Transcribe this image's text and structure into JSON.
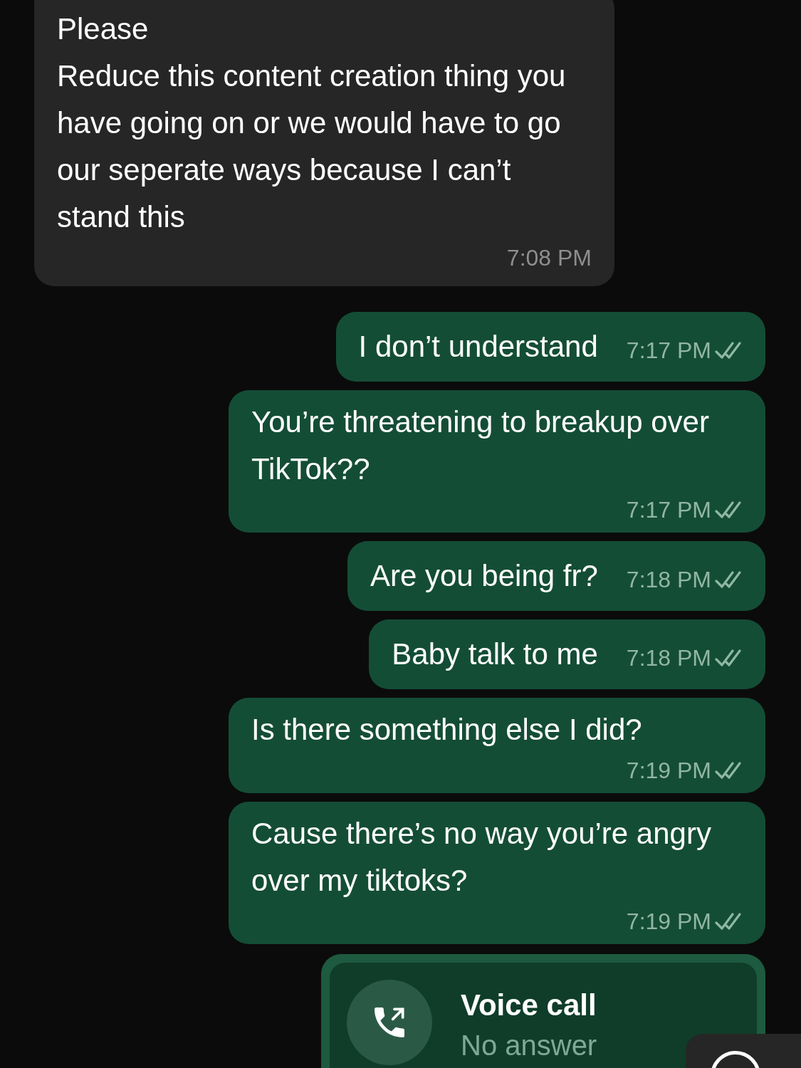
{
  "messages": [
    {
      "kind": "received",
      "text": "Please\nReduce this content creation thing you have going on or we would have to go our seperate ways because I can’t stand this",
      "time": "7:08 PM"
    },
    {
      "kind": "short",
      "text": "I don’t understand",
      "time": "7:17 PM",
      "read": true
    },
    {
      "kind": "long",
      "text": "You’re threatening to breakup over TikTok??",
      "time": "7:17 PM",
      "read": true
    },
    {
      "kind": "short",
      "text": "Are you being fr?",
      "time": "7:18 PM",
      "read": true
    },
    {
      "kind": "short",
      "text": "Baby talk to me",
      "time": "7:18 PM",
      "read": true
    },
    {
      "kind": "long",
      "text": "Is there something else I did?",
      "time": "7:19 PM",
      "read": true
    },
    {
      "kind": "long",
      "text": "Cause there’s no way you’re angry over my tiktoks?",
      "time": "7:19 PM",
      "read": true
    }
  ],
  "call": {
    "title": "Voice call",
    "status": "No answer"
  }
}
